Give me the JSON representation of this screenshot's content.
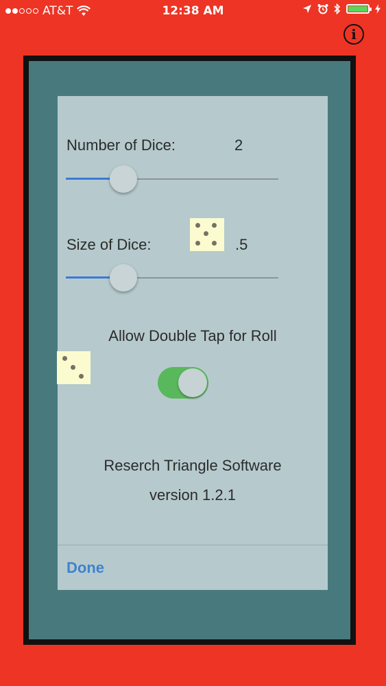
{
  "status_bar": {
    "carrier": "AT&T",
    "time": "12:38 AM",
    "signal_filled": 2,
    "signal_total": 5,
    "icons": [
      "wifi-icon",
      "location-arrow-icon",
      "alarm-icon",
      "bluetooth-icon",
      "battery-icon",
      "charging-bolt-icon"
    ]
  },
  "info_button": {
    "glyph": "i"
  },
  "settings": {
    "number_of_dice": {
      "label": "Number of Dice:",
      "value": "2",
      "slider_fraction": 0.27
    },
    "size_of_dice": {
      "label": "Size of Dice:",
      "value": ".5",
      "slider_fraction": 0.27
    },
    "double_tap": {
      "label": "Allow Double Tap for Roll",
      "enabled": true
    }
  },
  "footer": {
    "company": "Reserch Triangle Software",
    "version": "version 1.2.1",
    "done_label": "Done"
  },
  "colors": {
    "background": "#ee3424",
    "frame": "#111111",
    "frame_inner": "#487a7d",
    "panel": "#b6cacd",
    "slider_fill": "#3a79d6",
    "toggle_on": "#59b85c",
    "done": "#3f82cf",
    "die_face": "#fbfbd0"
  }
}
